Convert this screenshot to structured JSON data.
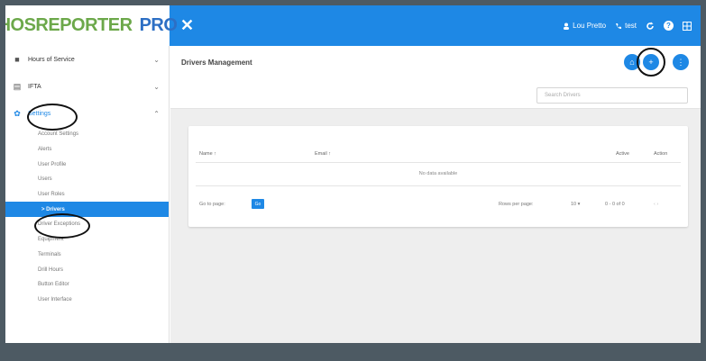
{
  "brand": {
    "part1": "HOSREPORTER",
    "part2": "PRO"
  },
  "topbar": {
    "close_glyph": "✕",
    "user_name": "Lou Pretto",
    "extra_label": "test",
    "icons": [
      "user-icon",
      "phone-icon",
      "refresh-icon",
      "help-icon",
      "grid-icon"
    ]
  },
  "sidebar": {
    "sections": [
      {
        "label": "Hours of Service",
        "chevron": "⌄"
      },
      {
        "label": "IFTA",
        "chevron": "⌄"
      },
      {
        "label": "Settings",
        "chevron": "⌃"
      }
    ],
    "sub_items": [
      "Account Settings",
      "Alerts",
      "User Profile",
      "Users",
      "User Roles",
      "> Drivers",
      "Driver Exceptions",
      "Equipment",
      "Terminals",
      "Drill Hours",
      "Button Editor",
      "User Interface"
    ]
  },
  "main": {
    "title": "Drivers Management",
    "search_placeholder": "Search Drivers",
    "fab_labels": [
      "⌂",
      "+",
      "⋮"
    ]
  },
  "table": {
    "headers": [
      "Name ↑",
      "Email ↑",
      "Active",
      "Action"
    ],
    "empty_text": "No data available",
    "goto_label": "Go to page:",
    "goto_button": "Go",
    "rows_per_page_label": "Rows per page:",
    "rows_per_page_value": "10 ▾",
    "range_text": "0 - 0 of 0",
    "pager": "‹ ›"
  },
  "colors": {
    "accent": "#1e88e5",
    "frame": "#4d5a63"
  }
}
